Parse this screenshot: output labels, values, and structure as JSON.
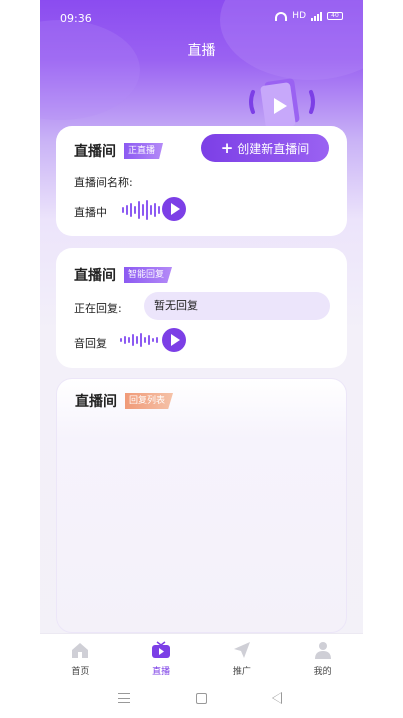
{
  "status": {
    "time": "09:36",
    "network": "HD",
    "battery": "40"
  },
  "header": {
    "title": "直播"
  },
  "card1": {
    "title": "直播间",
    "tag": "正直播",
    "create_button": "创建新直播间",
    "name_label": "直播间名称:",
    "live_label": "直播中"
  },
  "card2": {
    "title": "直播间",
    "tag": "智能回复",
    "replying_label": "正在回复:",
    "reply_value": "暂无回复",
    "audio_label": "音回复"
  },
  "card3": {
    "title": "直播间",
    "tag": "回复列表"
  },
  "tabs": [
    {
      "label": "首页",
      "icon": "home-icon"
    },
    {
      "label": "直播",
      "icon": "tv-icon"
    },
    {
      "label": "推广",
      "icon": "paper-plane-icon"
    },
    {
      "label": "我的",
      "icon": "user-icon"
    }
  ],
  "colors": {
    "accent": "#7c3fe6",
    "accent_light": "#9a62f2",
    "tag_orange": "#f09a78"
  }
}
